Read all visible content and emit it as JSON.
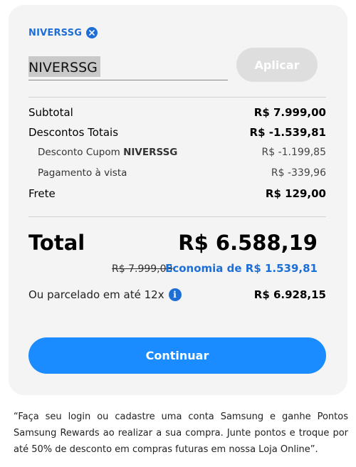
{
  "coupon": {
    "applied_code": "NIVERSSG",
    "input_value": "NIVERSSG",
    "apply_label": "Aplicar"
  },
  "summary": {
    "subtotal_label": "Subtotal",
    "subtotal_value": "R$ 7.999,00",
    "discounts_label": "Descontos Totais",
    "discounts_value": "R$ -1.539,81",
    "coupon_discount_prefix": "Desconto Cupom ",
    "coupon_discount_code": "NIVERSSG",
    "coupon_discount_value": "R$ -1.199,85",
    "cash_payment_label": "Pagamento à vista",
    "cash_payment_value": "R$ -339,96",
    "shipping_label": "Frete",
    "shipping_value": "R$ 129,00"
  },
  "total": {
    "label": "Total",
    "value": "R$ 6.588,19",
    "old_price": "R$ 7.999,00",
    "savings": "Economia de R$ 1.539,81",
    "installment_label": "Ou parcelado em até 12x",
    "installment_value": "R$ 6.928,15"
  },
  "continue_label": "Continuar",
  "footnote": "“Faça seu login ou cadastre uma conta Samsung e ganhe Pontos Samsung Rewards ao realizar a sua compra. Junte pontos e troque por até 50% de desconto em compras futuras em nossa Loja Online”.",
  "colors": {
    "accent": "#1d6fd6",
    "button": "#1a8cff",
    "card": "#f4f4f4"
  },
  "icons": [
    "close-icon",
    "info-icon"
  ]
}
